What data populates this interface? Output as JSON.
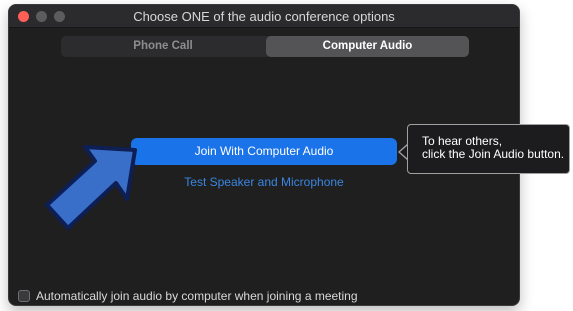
{
  "window": {
    "title": "Choose ONE of the audio conference options"
  },
  "tabs": [
    {
      "label": "Phone Call",
      "selected": false
    },
    {
      "label": "Computer Audio",
      "selected": true
    }
  ],
  "main": {
    "join_button_label": "Join With Computer Audio",
    "test_link_label": "Test Speaker and Microphone"
  },
  "footer": {
    "auto_join_label": "Automatically join audio by computer when joining a meeting",
    "auto_join_checked": false
  },
  "tooltip": {
    "line1": "To hear others,",
    "line2": "click the Join Audio button."
  },
  "colors": {
    "accent": "#1a73e8",
    "link": "#3a86e0",
    "window_bg": "#1f1f20",
    "annotation_arrow": "#3a6fc9"
  },
  "icons": {
    "close": "traffic-close-icon",
    "minimize": "traffic-minimize-icon",
    "maximize": "traffic-maximize-icon",
    "annotation": "pointer-arrow-icon"
  }
}
